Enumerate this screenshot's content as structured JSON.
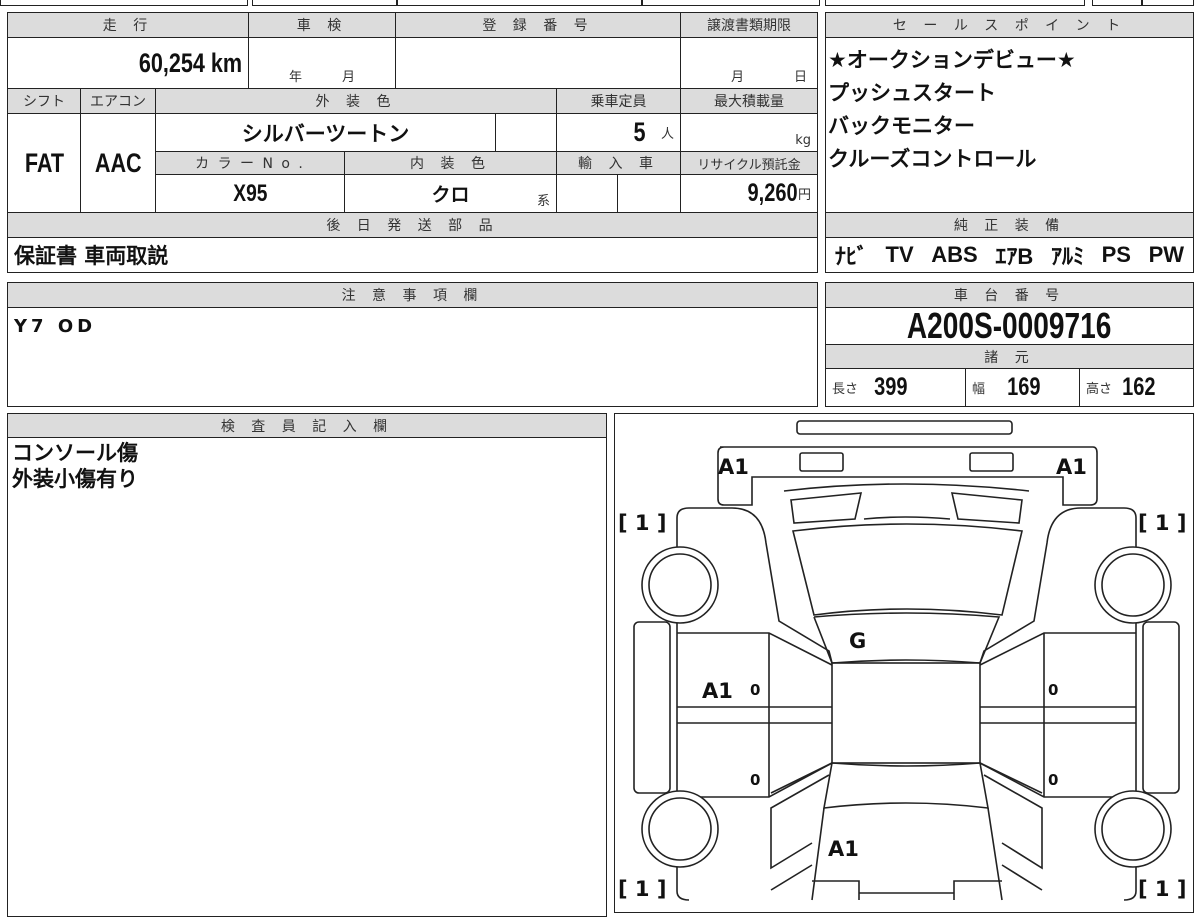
{
  "left_table": {
    "mileage_label": "走 行",
    "mileage_value": "60,254 km",
    "shaken_label": "車 検",
    "shaken_year": "年",
    "shaken_month": "月",
    "registration_label": "登 録 番 号",
    "transfer_deadline_label": "譲渡書類期限",
    "transfer_month": "月",
    "transfer_day": "日",
    "shift_label": "シフト",
    "shift_value": "FAT",
    "aircon_label": "エアコン",
    "aircon_value": "AAC",
    "exterior_color_label": "外 装 色",
    "exterior_color_value": "シルバーツートン",
    "capacity_label": "乗車定員",
    "capacity_value": "5",
    "capacity_unit": "人",
    "max_load_label": "最大積載量",
    "max_load_unit": "kg",
    "color_no_label": "カ ラ ー N o .",
    "color_no_value": "X95",
    "interior_color_label": "内 装 色",
    "interior_color_value": "クロ",
    "interior_color_suffix": "系",
    "import_label": "輸 入 車",
    "recycle_label": "リサイクル預託金",
    "recycle_value": "9,260",
    "recycle_unit": "円",
    "later_parts_label": "後 日 発 送 部 品",
    "later_parts_value": "保証書 車両取説"
  },
  "notes": {
    "label": "注 意 事 項 欄",
    "value": "Y7 OD"
  },
  "inspector": {
    "label": "検 査 員 記 入 欄",
    "lines": [
      "コンソール傷",
      "外装小傷有り"
    ]
  },
  "sales_points": {
    "label": "セ ー ル ス ポ イ ン ト",
    "items": [
      "★オークションデビュー★",
      "プッシュスタート",
      "バックモニター",
      "クルーズコントロール"
    ]
  },
  "equipment": {
    "label": "純 正 装 備",
    "items": [
      "ﾅﾋﾞ",
      "TV",
      "ABS",
      "ｴｱB",
      "ｱﾙﾐ",
      "PS",
      "PW"
    ]
  },
  "chassis": {
    "label": "車 台 番 号",
    "value": "A200S-0009716"
  },
  "specs": {
    "label": "諸 元",
    "length_label": "長さ",
    "length_value": "399",
    "width_label": "幅",
    "width_value": "169",
    "height_label": "高さ",
    "height_value": "162"
  },
  "diagram": {
    "front_left": "A1",
    "front_right": "A1",
    "corner_fl": "[ 1 ]",
    "corner_fr": "[ 1 ]",
    "corner_rl": "[ 1 ]",
    "corner_rr": "[ 1 ]",
    "windshield": "G",
    "left_front_door": "A1",
    "mark_lf": "0",
    "mark_lr": "0",
    "mark_rf": "0",
    "mark_rr": "0",
    "rear": "A1"
  }
}
